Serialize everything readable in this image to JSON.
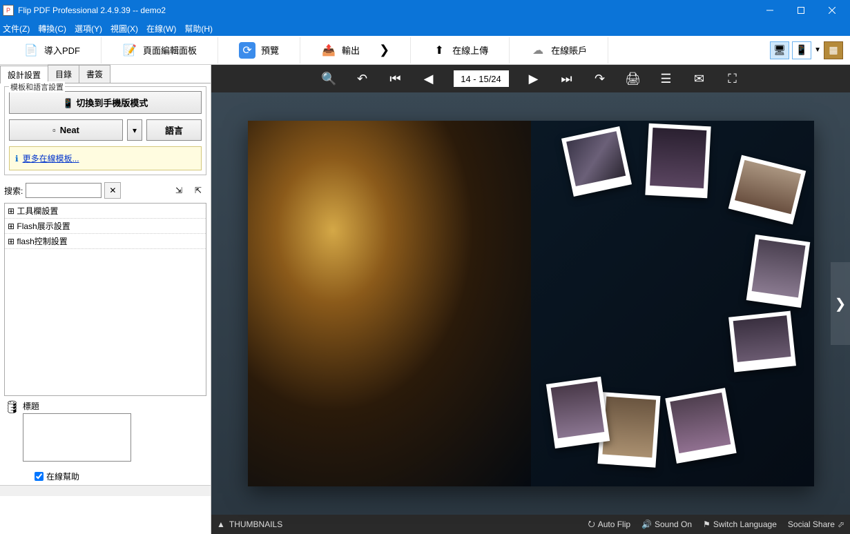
{
  "title": "Flip PDF Professional 2.4.9.39 -- demo2",
  "menus": [
    "文件(Z)",
    "轉換(C)",
    "選項(Y)",
    "視圖(X)",
    "在線(W)",
    "幫助(H)"
  ],
  "toolbar": {
    "import": "導入PDF",
    "editpanel": "頁面編輯面板",
    "preview": "預覽",
    "output": "輸出",
    "upload": "在線上傳",
    "account": "在線賬戶"
  },
  "sidebar": {
    "tabs": [
      "設計設置",
      "目錄",
      "書簽"
    ],
    "active_tab": 0,
    "group_title": "模板和語言設置",
    "mobile_btn": "切換到手機版模式",
    "theme_btn": "Neat",
    "lang_btn": "語言",
    "more_link": "更多在線模板...",
    "search_label": "搜索:",
    "search_value": "",
    "props": [
      "⊞ 工具欄設置",
      "⊞ Flash展示設置",
      "⊞ flash控制設置"
    ],
    "title_label": "標題",
    "title_value": "",
    "online_help": "在線幫助"
  },
  "preview": {
    "page_display": "14 - 15/24",
    "thumbnails": "THUMBNAILS",
    "autoflip": "Auto Flip",
    "sound": "Sound On",
    "switchlang": "Switch Language",
    "share": "Social Share"
  }
}
